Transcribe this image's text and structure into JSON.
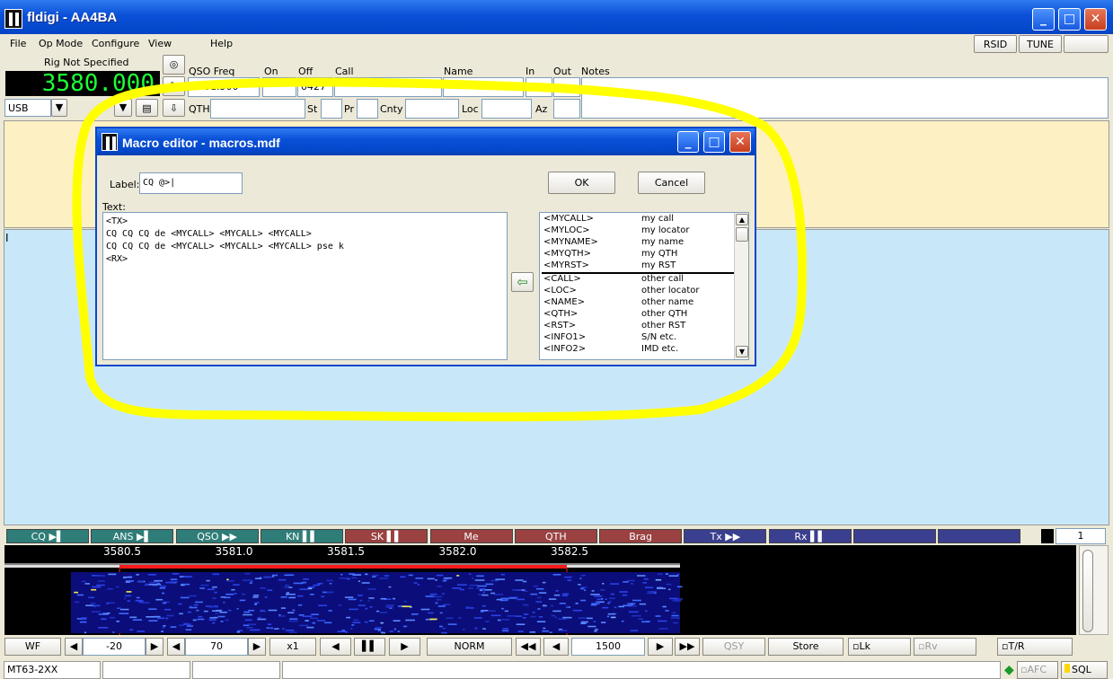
{
  "app": {
    "title": "fldigi - AA4BA"
  },
  "menu": {
    "file": "File",
    "opmode": "Op Mode",
    "configure": "Configure",
    "view": "View",
    "help": "Help",
    "rsid": "RSID",
    "tune": "TUNE"
  },
  "rig": {
    "label": "Rig Not Specified",
    "freq": "3580.000",
    "mode": "USB"
  },
  "qso": {
    "freq_label": "QSO Freq",
    "freq_value": "3581.500",
    "on_label": "On",
    "off_label": "Off",
    "off_value": "0427",
    "call_label": "Call",
    "name_label": "Name",
    "in_label": "In",
    "out_label": "Out",
    "notes_label": "Notes",
    "qth_label": "QTH",
    "st_label": "St",
    "pr_label": "Pr",
    "cnty_label": "Cnty",
    "loc_label": "Loc",
    "az_label": "Az"
  },
  "dialog": {
    "title": "Macro editor - macros.mdf",
    "label_caption": "Label:",
    "label_value": "CQ @>|",
    "ok": "OK",
    "cancel": "Cancel",
    "text_caption": "Text:",
    "text_lines": [
      "<TX>",
      "CQ CQ CQ de <MYCALL> <MYCALL> <MYCALL>",
      "CQ CQ CQ de <MYCALL> <MYCALL> <MYCALL> pse k",
      "<RX>"
    ],
    "tags": [
      {
        "tag": "<MYCALL>",
        "desc": "my call"
      },
      {
        "tag": "<MYLOC>",
        "desc": "my locator"
      },
      {
        "tag": "<MYNAME>",
        "desc": "my name"
      },
      {
        "tag": "<MYQTH>",
        "desc": "my QTH"
      },
      {
        "tag": "<MYRST>",
        "desc": "my RST"
      },
      {
        "tag": "<CALL>",
        "desc": "other call"
      },
      {
        "tag": "<LOC>",
        "desc": "other locator"
      },
      {
        "tag": "<NAME>",
        "desc": "other name"
      },
      {
        "tag": "<QTH>",
        "desc": "other QTH"
      },
      {
        "tag": "<RST>",
        "desc": "other RST"
      },
      {
        "tag": "<INFO1>",
        "desc": "S/N etc."
      },
      {
        "tag": "<INFO2>",
        "desc": "IMD etc."
      }
    ]
  },
  "macros": [
    {
      "label": "CQ ▶▌",
      "color": "#2e7d78"
    },
    {
      "label": "ANS ▶▌",
      "color": "#2e7d78"
    },
    {
      "label": "QSO ▶▶",
      "color": "#2e7d78"
    },
    {
      "label": "KN ▌▌",
      "color": "#2e7d78"
    },
    {
      "label": "SK ▌▌",
      "color": "#9b4141"
    },
    {
      "label": "Me",
      "color": "#9b4141"
    },
    {
      "label": "QTH",
      "color": "#9b4141"
    },
    {
      "label": "Brag",
      "color": "#9b4141"
    },
    {
      "label": "Tx ▶▶",
      "color": "#3b3f8f"
    },
    {
      "label": "Rx ▌▌",
      "color": "#3b3f8f"
    },
    {
      "label": "",
      "color": "#3b3f8f"
    },
    {
      "label": "",
      "color": "#3b3f8f"
    }
  ],
  "macro_page": "1",
  "waterfall": {
    "ticks": [
      "3580.5",
      "3581.0",
      "3581.5",
      "3582.0",
      "3582.5"
    ]
  },
  "toolbar": {
    "wf": "WF",
    "level1": "-20",
    "level2": "70",
    "zoom": "x1",
    "norm": "NORM",
    "freq": "1500",
    "qsy": "QSY",
    "store": "Store",
    "lk": "Lk",
    "rv": "Rv",
    "tr": "T/R"
  },
  "status": {
    "mode": "MT63-2XX",
    "afc": "AFC",
    "sql": "SQL"
  }
}
